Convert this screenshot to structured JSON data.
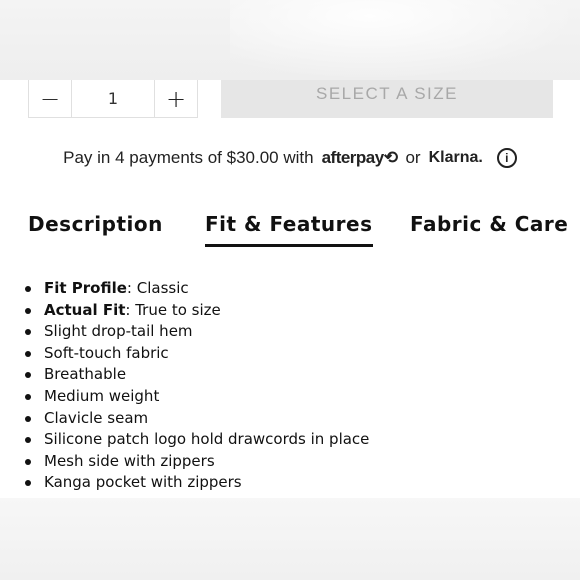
{
  "quantity": {
    "minus_label": "−",
    "value": "1",
    "plus_label": "+"
  },
  "select_size_label": "SELECT A SIZE",
  "payment": {
    "text": "Pay in 4 payments of $30.00 with",
    "afterpay_label": "afterpay⟲",
    "or_text": "or",
    "klarna_label": "Klarna.",
    "info_label": "i"
  },
  "tabs": [
    {
      "label": "Description",
      "active": false
    },
    {
      "label": "Fit & Features",
      "active": true
    },
    {
      "label": "Fabric & Care",
      "active": false
    }
  ],
  "features": [
    {
      "bold": "Fit Profile",
      "text": ": Classic"
    },
    {
      "bold": "Actual Fit",
      "text": ": True to size"
    },
    {
      "bold": "",
      "text": "Slight drop-tail hem"
    },
    {
      "bold": "",
      "text": "Soft-touch fabric"
    },
    {
      "bold": "",
      "text": "Breathable"
    },
    {
      "bold": "",
      "text": "Medium weight"
    },
    {
      "bold": "",
      "text": "Clavicle seam"
    },
    {
      "bold": "",
      "text": "Silicone patch logo hold drawcords in place"
    },
    {
      "bold": "",
      "text": "Mesh side with zippers"
    },
    {
      "bold": "",
      "text": "Kanga pocket with zippers"
    }
  ]
}
